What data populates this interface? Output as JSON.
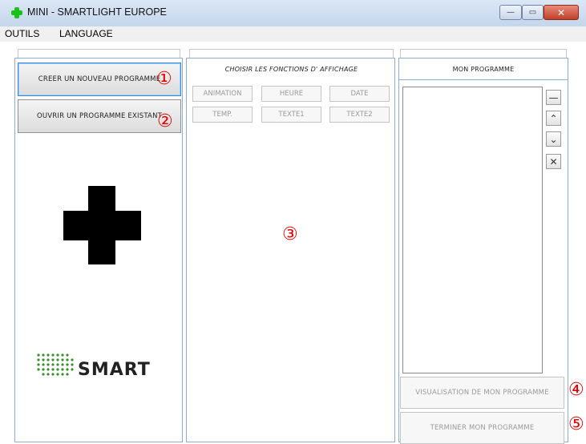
{
  "window": {
    "title": "MINI  - SMARTLIGHT EUROPE",
    "icon": "green-plus-icon",
    "min_glyph": "—",
    "max_glyph": "▭",
    "close_glyph": "✕"
  },
  "menu": {
    "items": [
      "OUTILS",
      "LANGUAGE"
    ]
  },
  "left_panel": {
    "create_button": "CREER UN NOUVEAU PROGRAMME",
    "open_button": "OUVRIR UN PROGRAMME EXISTANT",
    "logo_text": "SMART"
  },
  "middle_panel": {
    "title": "CHOISIR LES FONCTIONS D' AFFICHAGE",
    "functions": [
      "ANIMATION",
      "HEURE",
      "DATE",
      "TEMP.",
      "TEXTE1",
      "TEXTE2"
    ]
  },
  "right_panel": {
    "title": "MON PROGRAMME",
    "side_buttons": [
      "—",
      "⌃",
      "⌄",
      "✕"
    ],
    "preview_button": "VISUALISATION DE MON PROGRAMME",
    "finish_button": "TERMINER MON PROGRAMME"
  },
  "annotations": [
    "①",
    "②",
    "③",
    "④",
    "⑤"
  ],
  "colors": {
    "accent_border": "#8eaed3",
    "annotation_red": "#e00000",
    "logo_green": "#3a8f2a",
    "icon_green": "#19c219"
  }
}
